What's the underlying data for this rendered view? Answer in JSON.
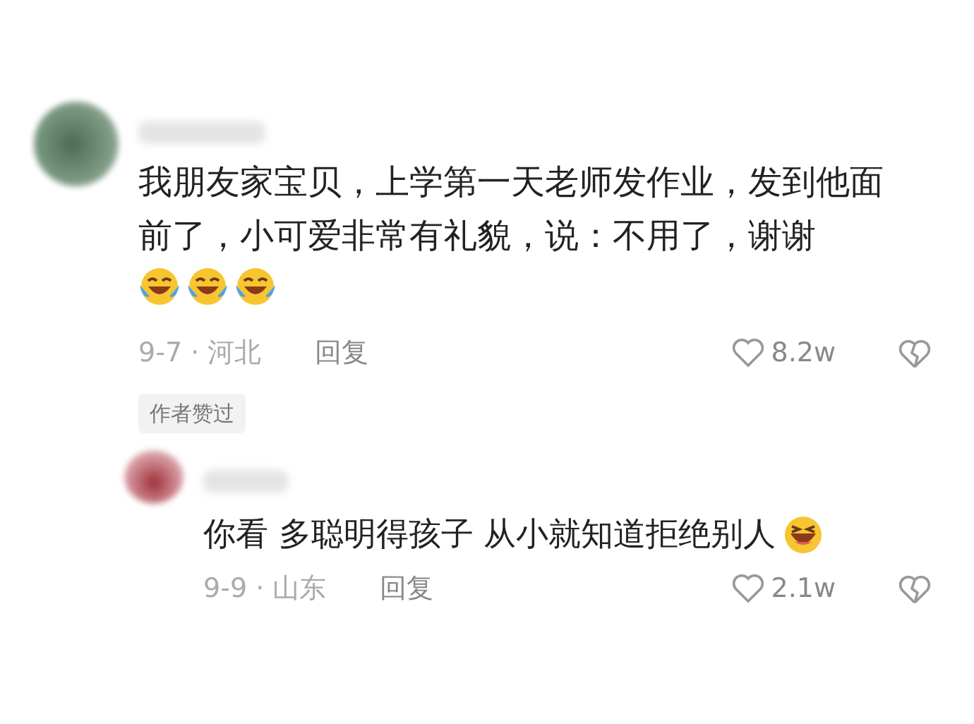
{
  "comments": [
    {
      "kind": "top",
      "text": "我朋友家宝贝，上学第一天老师发作业，发到他面前了，小可爱非常有礼貌，说：不用了，谢谢",
      "emojis": [
        {
          "kind": "tears"
        },
        {
          "kind": "tears"
        },
        {
          "kind": "tears"
        }
      ],
      "meta": "9-7 · 河北",
      "reply": "回复",
      "likes": "8.2w",
      "badge": "作者赞过"
    },
    {
      "kind": "reply",
      "text": "你看 多聪明得孩子 从小就知道拒绝别人",
      "emojis": [
        {
          "kind": "grin"
        }
      ],
      "meta": "9-9 · 山东",
      "reply": "回复",
      "likes": "2.1w"
    }
  ]
}
